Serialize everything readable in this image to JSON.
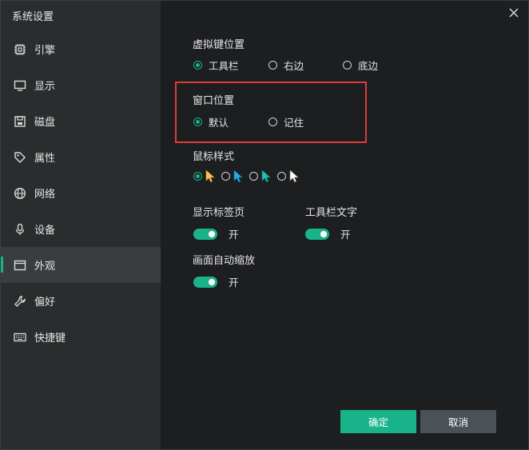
{
  "window": {
    "title": "系统设置"
  },
  "sidebar": {
    "items": [
      {
        "label": "引擎",
        "icon": "chip-icon"
      },
      {
        "label": "显示",
        "icon": "monitor-icon"
      },
      {
        "label": "磁盘",
        "icon": "disk-icon"
      },
      {
        "label": "属性",
        "icon": "tag-icon"
      },
      {
        "label": "网络",
        "icon": "globe-icon"
      },
      {
        "label": "设备",
        "icon": "microphone-icon"
      },
      {
        "label": "外观",
        "icon": "window-icon",
        "active": true
      },
      {
        "label": "偏好",
        "icon": "wrench-icon"
      },
      {
        "label": "快捷键",
        "icon": "keyboard-icon"
      }
    ]
  },
  "settings": {
    "vkey": {
      "label": "虚拟键位置",
      "options": [
        "工具栏",
        "右边",
        "底边"
      ],
      "selected": "工具栏"
    },
    "window_pos": {
      "label": "窗口位置",
      "options": [
        "默认",
        "记住"
      ],
      "selected": "默认"
    },
    "cursor_style": {
      "label": "鼠标样式",
      "options": [
        "yellow-arrow",
        "blue-arrow",
        "teal-arrow",
        "white-arrow"
      ],
      "colors": [
        "#f2c94c",
        "#29a8ea",
        "#1fc2b3",
        "#ffffff"
      ],
      "selected": 0
    },
    "show_tabs": {
      "label": "显示标签页",
      "state": "开"
    },
    "toolbar_text": {
      "label": "工具栏文字",
      "state": "开"
    },
    "auto_zoom": {
      "label": "画面自动缩放",
      "state": "开"
    }
  },
  "buttons": {
    "ok": "确定",
    "cancel": "取消"
  },
  "colors": {
    "accent": "#19b38a",
    "highlight": "#e03a3a",
    "sidebar": "#2a2c2e",
    "background": "#1c1e20"
  }
}
